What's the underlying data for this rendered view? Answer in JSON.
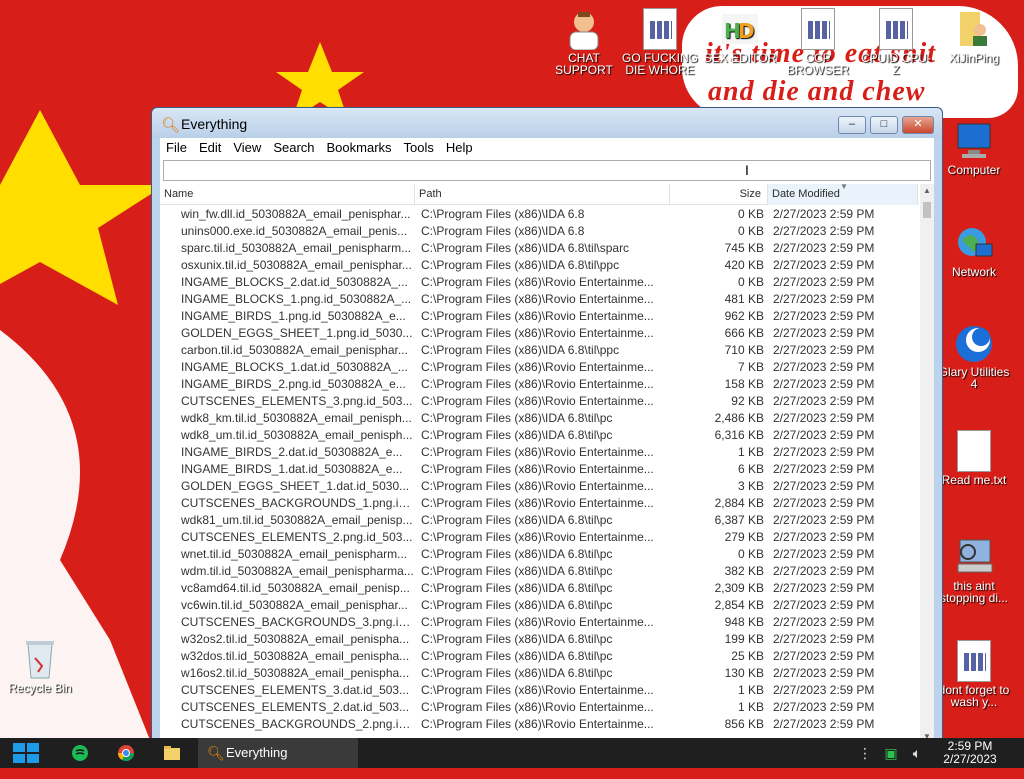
{
  "desktop": {
    "note_line1": "it's time to eat shit",
    "note_line2": "and die and chew",
    "icons": [
      {
        "label": "CHAT SUPPORT"
      },
      {
        "label": "GO FUCKING DIE WHORE"
      },
      {
        "label": "SEX EDITOR"
      },
      {
        "label": "CCP BROWSER"
      },
      {
        "label": "CPUID CPU-Z"
      },
      {
        "label": "XiJinPing"
      },
      {
        "label": "Computer"
      },
      {
        "label": "Network"
      },
      {
        "label": "Glary Utilities 4"
      },
      {
        "label": "Read me.txt"
      },
      {
        "label": "this aint stopping di..."
      },
      {
        "label": "dont forget to wash y..."
      },
      {
        "label": "Recycle Bin"
      }
    ]
  },
  "window": {
    "title": "Everything",
    "menu": [
      "File",
      "Edit",
      "View",
      "Search",
      "Bookmarks",
      "Tools",
      "Help"
    ],
    "search_value": "",
    "columns": {
      "name": "Name",
      "path": "Path",
      "size": "Size",
      "date": "Date Modified"
    },
    "rows": [
      {
        "name": "win_fw.dll.id_5030882A_email_penisphar...",
        "path": "C:\\Program Files (x86)\\IDA 6.8",
        "size": "0 KB",
        "date": "2/27/2023 2:59 PM"
      },
      {
        "name": "unins000.exe.id_5030882A_email_penis...",
        "path": "C:\\Program Files (x86)\\IDA 6.8",
        "size": "0 KB",
        "date": "2/27/2023 2:59 PM"
      },
      {
        "name": "sparc.til.id_5030882A_email_penispharm...",
        "path": "C:\\Program Files (x86)\\IDA 6.8\\til\\sparc",
        "size": "745 KB",
        "date": "2/27/2023 2:59 PM"
      },
      {
        "name": "osxunix.til.id_5030882A_email_penisphar...",
        "path": "C:\\Program Files (x86)\\IDA 6.8\\til\\ppc",
        "size": "420 KB",
        "date": "2/27/2023 2:59 PM"
      },
      {
        "name": "INGAME_BLOCKS_2.dat.id_5030882A_...",
        "path": "C:\\Program Files (x86)\\Rovio Entertainme...",
        "size": "0 KB",
        "date": "2/27/2023 2:59 PM"
      },
      {
        "name": "INGAME_BLOCKS_1.png.id_5030882A_...",
        "path": "C:\\Program Files (x86)\\Rovio Entertainme...",
        "size": "481 KB",
        "date": "2/27/2023 2:59 PM"
      },
      {
        "name": "INGAME_BIRDS_1.png.id_5030882A_e...",
        "path": "C:\\Program Files (x86)\\Rovio Entertainme...",
        "size": "962 KB",
        "date": "2/27/2023 2:59 PM"
      },
      {
        "name": "GOLDEN_EGGS_SHEET_1.png.id_5030...",
        "path": "C:\\Program Files (x86)\\Rovio Entertainme...",
        "size": "666 KB",
        "date": "2/27/2023 2:59 PM"
      },
      {
        "name": "carbon.til.id_5030882A_email_penisphar...",
        "path": "C:\\Program Files (x86)\\IDA 6.8\\til\\ppc",
        "size": "710 KB",
        "date": "2/27/2023 2:59 PM"
      },
      {
        "name": "INGAME_BLOCKS_1.dat.id_5030882A_...",
        "path": "C:\\Program Files (x86)\\Rovio Entertainme...",
        "size": "7 KB",
        "date": "2/27/2023 2:59 PM"
      },
      {
        "name": "INGAME_BIRDS_2.png.id_5030882A_e...",
        "path": "C:\\Program Files (x86)\\Rovio Entertainme...",
        "size": "158 KB",
        "date": "2/27/2023 2:59 PM"
      },
      {
        "name": "CUTSCENES_ELEMENTS_3.png.id_503...",
        "path": "C:\\Program Files (x86)\\Rovio Entertainme...",
        "size": "92 KB",
        "date": "2/27/2023 2:59 PM"
      },
      {
        "name": "wdk8_km.til.id_5030882A_email_penisph...",
        "path": "C:\\Program Files (x86)\\IDA 6.8\\til\\pc",
        "size": "2,486 KB",
        "date": "2/27/2023 2:59 PM"
      },
      {
        "name": "wdk8_um.til.id_5030882A_email_penisph...",
        "path": "C:\\Program Files (x86)\\IDA 6.8\\til\\pc",
        "size": "6,316 KB",
        "date": "2/27/2023 2:59 PM"
      },
      {
        "name": "INGAME_BIRDS_2.dat.id_5030882A_e...",
        "path": "C:\\Program Files (x86)\\Rovio Entertainme...",
        "size": "1 KB",
        "date": "2/27/2023 2:59 PM"
      },
      {
        "name": "INGAME_BIRDS_1.dat.id_5030882A_e...",
        "path": "C:\\Program Files (x86)\\Rovio Entertainme...",
        "size": "6 KB",
        "date": "2/27/2023 2:59 PM"
      },
      {
        "name": "GOLDEN_EGGS_SHEET_1.dat.id_5030...",
        "path": "C:\\Program Files (x86)\\Rovio Entertainme...",
        "size": "3 KB",
        "date": "2/27/2023 2:59 PM"
      },
      {
        "name": "CUTSCENES_BACKGROUNDS_1.png.id...",
        "path": "C:\\Program Files (x86)\\Rovio Entertainme...",
        "size": "2,884 KB",
        "date": "2/27/2023 2:59 PM"
      },
      {
        "name": "wdk81_um.til.id_5030882A_email_penisp...",
        "path": "C:\\Program Files (x86)\\IDA 6.8\\til\\pc",
        "size": "6,387 KB",
        "date": "2/27/2023 2:59 PM"
      },
      {
        "name": "CUTSCENES_ELEMENTS_2.png.id_503...",
        "path": "C:\\Program Files (x86)\\Rovio Entertainme...",
        "size": "279 KB",
        "date": "2/27/2023 2:59 PM"
      },
      {
        "name": "wnet.til.id_5030882A_email_penispharm...",
        "path": "C:\\Program Files (x86)\\IDA 6.8\\til\\pc",
        "size": "0 KB",
        "date": "2/27/2023 2:59 PM"
      },
      {
        "name": "wdm.til.id_5030882A_email_penispharma...",
        "path": "C:\\Program Files (x86)\\IDA 6.8\\til\\pc",
        "size": "382 KB",
        "date": "2/27/2023 2:59 PM"
      },
      {
        "name": "vc8amd64.til.id_5030882A_email_penisp...",
        "path": "C:\\Program Files (x86)\\IDA 6.8\\til\\pc",
        "size": "2,309 KB",
        "date": "2/27/2023 2:59 PM"
      },
      {
        "name": "vc6win.til.id_5030882A_email_penisphar...",
        "path": "C:\\Program Files (x86)\\IDA 6.8\\til\\pc",
        "size": "2,854 KB",
        "date": "2/27/2023 2:59 PM"
      },
      {
        "name": "CUTSCENES_BACKGROUNDS_3.png.id...",
        "path": "C:\\Program Files (x86)\\Rovio Entertainme...",
        "size": "948 KB",
        "date": "2/27/2023 2:59 PM"
      },
      {
        "name": "w32os2.til.id_5030882A_email_penispha...",
        "path": "C:\\Program Files (x86)\\IDA 6.8\\til\\pc",
        "size": "199 KB",
        "date": "2/27/2023 2:59 PM"
      },
      {
        "name": "w32dos.til.id_5030882A_email_penispha...",
        "path": "C:\\Program Files (x86)\\IDA 6.8\\til\\pc",
        "size": "25 KB",
        "date": "2/27/2023 2:59 PM"
      },
      {
        "name": "w16os2.til.id_5030882A_email_penispha...",
        "path": "C:\\Program Files (x86)\\IDA 6.8\\til\\pc",
        "size": "130 KB",
        "date": "2/27/2023 2:59 PM"
      },
      {
        "name": "CUTSCENES_ELEMENTS_3.dat.id_503...",
        "path": "C:\\Program Files (x86)\\Rovio Entertainme...",
        "size": "1 KB",
        "date": "2/27/2023 2:59 PM"
      },
      {
        "name": "CUTSCENES_ELEMENTS_2.dat.id_503...",
        "path": "C:\\Program Files (x86)\\Rovio Entertainme...",
        "size": "1 KB",
        "date": "2/27/2023 2:59 PM"
      },
      {
        "name": "CUTSCENES_BACKGROUNDS_2.png.id...",
        "path": "C:\\Program Files (x86)\\Rovio Entertainme...",
        "size": "856 KB",
        "date": "2/27/2023 2:59 PM"
      }
    ]
  },
  "taskbar": {
    "task_label": "Everything",
    "clock_time": "2:59 PM",
    "clock_date": "2/27/2023"
  },
  "colors": {
    "flag_red": "#d81e18",
    "star_yellow": "#ffde00",
    "taskbar": "#1f1f1f"
  }
}
